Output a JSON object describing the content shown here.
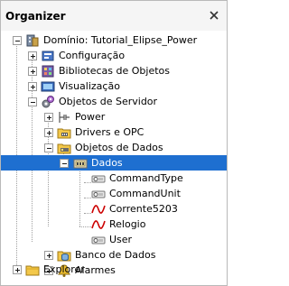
{
  "panel": {
    "title": "Organizer"
  },
  "tree": {
    "items": [
      {
        "label": "Domínio: Tutorial_Elipse_Power",
        "icon": "domain-icon",
        "expander": "minus"
      },
      {
        "label": "Configuração",
        "icon": "configuration-icon",
        "expander": "plus"
      },
      {
        "label": "Bibliotecas de Objetos",
        "icon": "libraries-icon",
        "expander": "plus"
      },
      {
        "label": "Visualização",
        "icon": "screens-icon",
        "expander": "plus"
      },
      {
        "label": "Objetos de Servidor",
        "icon": "server-objects-icon",
        "expander": "minus"
      },
      {
        "label": "Power",
        "icon": "power-icon",
        "expander": "plus"
      },
      {
        "label": "Drivers e OPC",
        "icon": "drivers-folder-icon",
        "expander": "plus"
      },
      {
        "label": "Objetos de Dados",
        "icon": "data-objects-folder-icon",
        "expander": "minus"
      },
      {
        "label": "Dados",
        "icon": "data-server-icon",
        "expander": "minus"
      },
      {
        "label": "CommandType",
        "icon": "demo-tag-icon"
      },
      {
        "label": "CommandUnit",
        "icon": "demo-tag-icon"
      },
      {
        "label": "Corrente5203",
        "icon": "sine-wave-icon"
      },
      {
        "label": "Relogio",
        "icon": "sine-wave-icon"
      },
      {
        "label": "User",
        "icon": "demo-tag-icon"
      },
      {
        "label": "Banco de Dados",
        "icon": "database-folder-icon",
        "expander": "plus"
      },
      {
        "label": "Alarmes",
        "icon": "alarms-icon",
        "expander": "plus"
      },
      {
        "label": "Explorer",
        "icon": "explorer-folder-icon",
        "expander": "plus"
      }
    ],
    "selected_item": "Dados"
  },
  "colors": {
    "selection": "#1e6fd0",
    "title_bg": "#f5f5f5",
    "border": "#b9b9b9",
    "tree_lines": "#a0a0a0",
    "sine_wave": "#cc0000"
  }
}
